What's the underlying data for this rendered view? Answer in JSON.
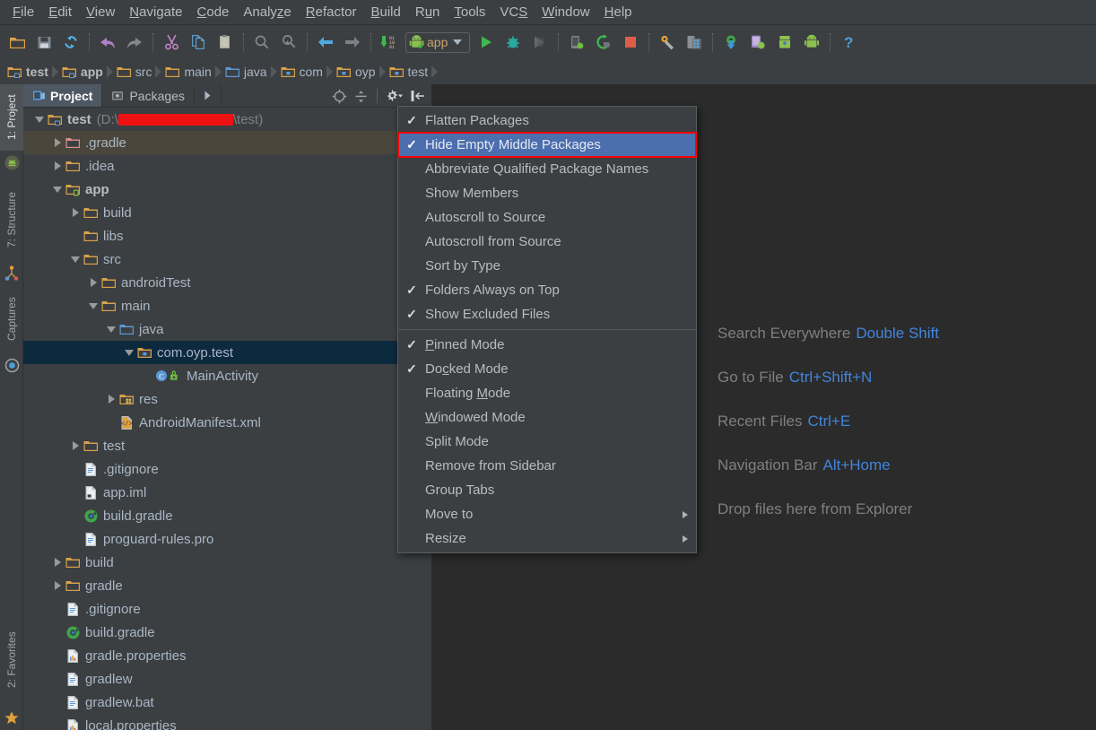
{
  "theme": {
    "panel_bg": "#3c3f41",
    "editor_bg": "#2b2b2b",
    "text": "#a9b7c6",
    "accent_blue": "#4285dc",
    "menu_highlight": "#4b6eaf",
    "highlight_outline": "#ff0000",
    "tree_selection": "#0d293e",
    "tree_hover": "#4b463b"
  },
  "menubar": {
    "items": [
      {
        "label": "File",
        "mnemonic": "F"
      },
      {
        "label": "Edit",
        "mnemonic": "E"
      },
      {
        "label": "View",
        "mnemonic": "V"
      },
      {
        "label": "Navigate",
        "mnemonic": "N"
      },
      {
        "label": "Code",
        "mnemonic": "C"
      },
      {
        "label": "Analyze",
        "mnemonic": "z"
      },
      {
        "label": "Refactor",
        "mnemonic": "R"
      },
      {
        "label": "Build",
        "mnemonic": "B"
      },
      {
        "label": "Run",
        "mnemonic": "u"
      },
      {
        "label": "Tools",
        "mnemonic": "T"
      },
      {
        "label": "VCS",
        "mnemonic": "S"
      },
      {
        "label": "Window",
        "mnemonic": "W"
      },
      {
        "label": "Help",
        "mnemonic": "H"
      }
    ]
  },
  "toolbar": {
    "run_config_label": "app",
    "buttons": [
      "open-folder-icon",
      "save-all-icon",
      "sync-refresh-icon",
      "undo-icon",
      "redo-icon",
      "cut-icon",
      "copy-icon",
      "paste-icon",
      "find-icon",
      "find-replace-icon",
      "back-icon",
      "forward-icon",
      "update-project-icon",
      "run-icon",
      "debug-icon",
      "run-coverage-icon",
      "attach-debugger-icon",
      "rerun-icon",
      "stop-icon",
      "sdk-manager-icon",
      "avd-manager-icon",
      "sync-gradle-icon",
      "device-monitor-icon",
      "avd-icon",
      "android-icon",
      "help-icon"
    ]
  },
  "navbar": {
    "crumbs": [
      {
        "label": "test",
        "icon": "module-folder-icon",
        "bold": true
      },
      {
        "label": "app",
        "icon": "module-folder-icon",
        "bold": true
      },
      {
        "label": "src",
        "icon": "folder-icon",
        "bold": false
      },
      {
        "label": "main",
        "icon": "folder-icon",
        "bold": false
      },
      {
        "label": "java",
        "icon": "source-root-icon",
        "bold": false
      },
      {
        "label": "com",
        "icon": "package-icon",
        "bold": false
      },
      {
        "label": "oyp",
        "icon": "package-icon",
        "bold": false
      },
      {
        "label": "test",
        "icon": "package-icon",
        "bold": false
      }
    ]
  },
  "left_stripe": {
    "top_items": [
      {
        "label": "1: Project",
        "mnemonic": "1",
        "icon": "android-project-icon",
        "active": true
      },
      {
        "label": "7: Structure",
        "mnemonic": "7",
        "icon": "structure-icon",
        "active": false
      },
      {
        "label": "Captures",
        "mnemonic": "",
        "icon": "captures-icon",
        "active": false
      }
    ],
    "bottom_items": [
      {
        "label": "2: Favorites",
        "mnemonic": "2",
        "icon": "star-icon",
        "active": false
      }
    ]
  },
  "tool_window": {
    "tabs": [
      {
        "label": "Project",
        "icon": "project-view-icon",
        "active": true
      },
      {
        "label": "Packages",
        "icon": "packages-view-icon",
        "active": false
      }
    ],
    "more_tabs_icon": "chevron-right-icon",
    "actions": [
      "scroll-from-source-icon",
      "collapse-all-icon",
      "settings-gear-icon",
      "hide-icon"
    ]
  },
  "tree": {
    "rows": [
      {
        "indent": 0,
        "toggle": "down",
        "icon": "module-folder-icon",
        "label": "test",
        "bold": true,
        "path_prefix": "(D:\\",
        "path_redacted": true,
        "path_suffix": "\\test)",
        "state": "normal"
      },
      {
        "indent": 1,
        "toggle": "right",
        "icon": "folder-excluded-icon",
        "label": ".gradle",
        "state": "hover"
      },
      {
        "indent": 1,
        "toggle": "right",
        "icon": "folder-icon",
        "label": ".idea",
        "state": "normal"
      },
      {
        "indent": 1,
        "toggle": "down",
        "icon": "module-app-icon",
        "label": "app",
        "bold": true,
        "state": "normal"
      },
      {
        "indent": 2,
        "toggle": "right",
        "icon": "folder-icon",
        "label": "build",
        "state": "normal"
      },
      {
        "indent": 2,
        "toggle": "none",
        "icon": "folder-icon",
        "label": "libs",
        "state": "normal"
      },
      {
        "indent": 2,
        "toggle": "down",
        "icon": "folder-icon",
        "label": "src",
        "state": "normal"
      },
      {
        "indent": 3,
        "toggle": "right",
        "icon": "folder-icon",
        "label": "androidTest",
        "state": "normal"
      },
      {
        "indent": 3,
        "toggle": "down",
        "icon": "folder-icon",
        "label": "main",
        "state": "normal"
      },
      {
        "indent": 4,
        "toggle": "down",
        "icon": "source-root-icon",
        "label": "java",
        "state": "normal"
      },
      {
        "indent": 5,
        "toggle": "down",
        "icon": "package-icon",
        "label": "com.oyp.test",
        "state": "selected"
      },
      {
        "indent": 6,
        "toggle": "none",
        "icon": "java-class-icon",
        "label": "MainActivity",
        "state": "normal"
      },
      {
        "indent": 4,
        "toggle": "right",
        "icon": "res-folder-icon",
        "label": "res",
        "state": "normal"
      },
      {
        "indent": 4,
        "toggle": "none",
        "icon": "xml-file-icon",
        "label": "AndroidManifest.xml",
        "state": "normal"
      },
      {
        "indent": 2,
        "toggle": "right",
        "icon": "folder-icon",
        "label": "test",
        "state": "normal"
      },
      {
        "indent": 2,
        "toggle": "none",
        "icon": "text-file-icon",
        "label": ".gitignore",
        "state": "normal"
      },
      {
        "indent": 2,
        "toggle": "none",
        "icon": "iml-file-icon",
        "label": "app.iml",
        "state": "normal"
      },
      {
        "indent": 2,
        "toggle": "none",
        "icon": "gradle-file-icon",
        "label": "build.gradle",
        "state": "normal"
      },
      {
        "indent": 2,
        "toggle": "none",
        "icon": "text-file-icon",
        "label": "proguard-rules.pro",
        "state": "normal"
      },
      {
        "indent": 1,
        "toggle": "right",
        "icon": "folder-icon",
        "label": "build",
        "state": "normal"
      },
      {
        "indent": 1,
        "toggle": "right",
        "icon": "folder-icon",
        "label": "gradle",
        "state": "normal"
      },
      {
        "indent": 1,
        "toggle": "none",
        "icon": "text-file-icon",
        "label": ".gitignore",
        "state": "normal"
      },
      {
        "indent": 1,
        "toggle": "none",
        "icon": "gradle-file-icon",
        "label": "build.gradle",
        "state": "normal"
      },
      {
        "indent": 1,
        "toggle": "none",
        "icon": "properties-file-icon",
        "label": "gradle.properties",
        "state": "normal"
      },
      {
        "indent": 1,
        "toggle": "none",
        "icon": "text-file-icon",
        "label": "gradlew",
        "state": "normal"
      },
      {
        "indent": 1,
        "toggle": "none",
        "icon": "text-file-icon",
        "label": "gradlew.bat",
        "state": "normal"
      },
      {
        "indent": 1,
        "toggle": "none",
        "icon": "properties-file-icon",
        "label": "local.properties",
        "state": "normal"
      }
    ]
  },
  "context_menu": {
    "items": [
      {
        "label": "Flatten Packages",
        "checked": true,
        "mnemonic": "",
        "submenu": false,
        "highlighted": false
      },
      {
        "label": "Hide Empty Middle Packages",
        "checked": true,
        "mnemonic": "",
        "submenu": false,
        "highlighted": true
      },
      {
        "label": "Abbreviate Qualified Package Names",
        "checked": false,
        "submenu": false,
        "highlighted": false
      },
      {
        "label": "Show Members",
        "checked": false,
        "submenu": false,
        "highlighted": false
      },
      {
        "label": "Autoscroll to Source",
        "checked": false,
        "submenu": false,
        "highlighted": false
      },
      {
        "label": "Autoscroll from Source",
        "checked": false,
        "submenu": false,
        "highlighted": false
      },
      {
        "label": "Sort by Type",
        "checked": false,
        "submenu": false,
        "highlighted": false
      },
      {
        "label": "Folders Always on Top",
        "checked": true,
        "submenu": false,
        "highlighted": false
      },
      {
        "label": "Show Excluded Files",
        "checked": true,
        "submenu": false,
        "highlighted": false
      },
      {
        "separator": true
      },
      {
        "label": "Pinned Mode",
        "checked": true,
        "mnemonic": "P",
        "submenu": false,
        "highlighted": false
      },
      {
        "label": "Docked Mode",
        "checked": true,
        "mnemonic": "c",
        "submenu": false,
        "highlighted": false
      },
      {
        "label": "Floating Mode",
        "checked": false,
        "mnemonic": "M",
        "submenu": false,
        "highlighted": false
      },
      {
        "label": "Windowed Mode",
        "checked": false,
        "mnemonic": "W",
        "submenu": false,
        "highlighted": false
      },
      {
        "label": "Split Mode",
        "checked": false,
        "submenu": false,
        "highlighted": false
      },
      {
        "label": "Remove from Sidebar",
        "checked": false,
        "submenu": false,
        "highlighted": false
      },
      {
        "label": "Group Tabs",
        "checked": false,
        "submenu": false,
        "highlighted": false
      },
      {
        "label": "Move to",
        "checked": false,
        "submenu": true,
        "highlighted": false
      },
      {
        "label": "Resize",
        "checked": false,
        "submenu": true,
        "highlighted": false
      }
    ],
    "check_glyph": "✓"
  },
  "editor_hints": [
    {
      "action": "Search Everywhere",
      "shortcut": "Double Shift"
    },
    {
      "action": "Go to File",
      "shortcut": "Ctrl+Shift+N"
    },
    {
      "action": "Recent Files",
      "shortcut": "Ctrl+E"
    },
    {
      "action": "Navigation Bar",
      "shortcut": "Alt+Home"
    },
    {
      "action": "Drop files here from Explorer",
      "shortcut": ""
    }
  ]
}
